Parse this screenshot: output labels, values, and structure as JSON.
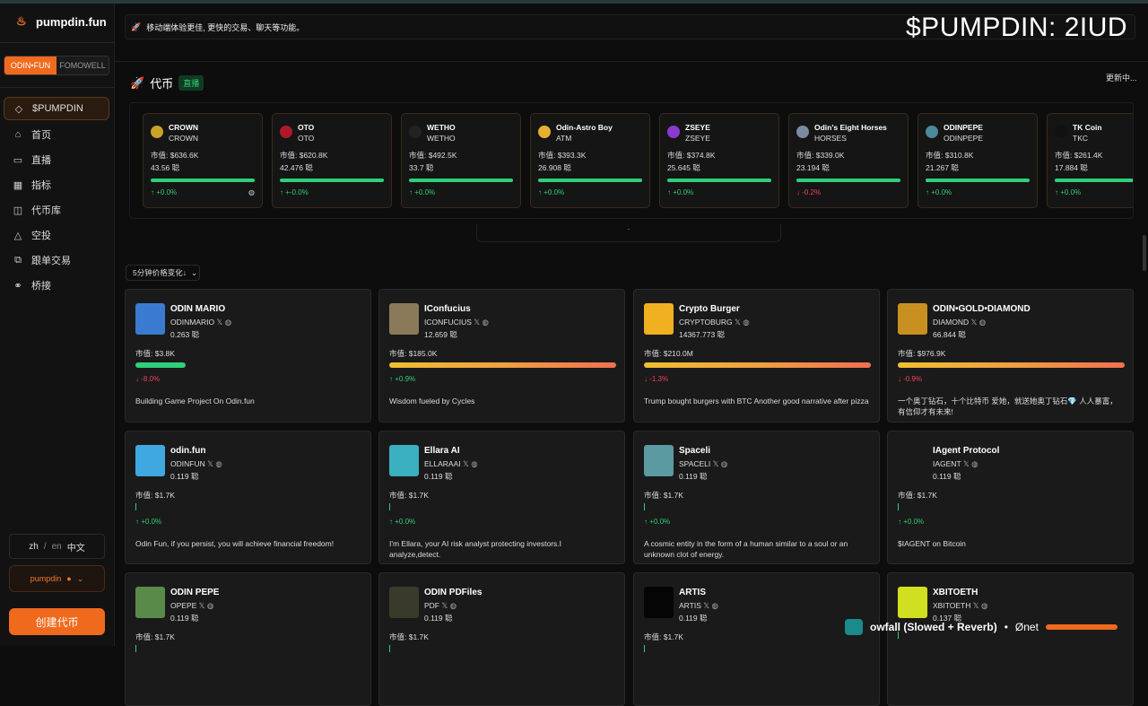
{
  "app": {
    "name": "pumpdin.fun"
  },
  "switch": {
    "active": "ODIN•FUN",
    "inactive": "FOMOWELL"
  },
  "nav": [
    {
      "label": "$PUMPDIN",
      "icon": "◇"
    },
    {
      "label": "首页",
      "icon": "⌂"
    },
    {
      "label": "直播",
      "icon": "▭"
    },
    {
      "label": "指标",
      "icon": "▦"
    },
    {
      "label": "代币库",
      "icon": "◫"
    },
    {
      "label": "空投",
      "icon": "△"
    },
    {
      "label": "跟单交易",
      "icon": "⧉"
    },
    {
      "label": "桥接",
      "icon": "⚭"
    }
  ],
  "lang": {
    "a": "zh",
    "sep": "/",
    "b": "en",
    "c": "中文"
  },
  "user": {
    "name": "pumpdin"
  },
  "create_label": "创建代币",
  "banner": {
    "text": "移动端体验更佳, 更快的交易、聊天等功能。"
  },
  "ticker": "$PUMPDIN: 2IUD",
  "section": {
    "title": "代币",
    "live": "直播",
    "updating": "更新中..."
  },
  "trending": [
    {
      "name": "CROWN",
      "symbol": "CROWN",
      "mcap": "市值: $636.6K",
      "holders": "43.56 聪",
      "change": "↑ +0.0%",
      "dir": "up",
      "color": "#c9a227"
    },
    {
      "name": "OTO",
      "symbol": "OTO",
      "mcap": "市值: $620.8K",
      "holders": "42.476 聪",
      "change": "↑ +-0.0%",
      "dir": "up",
      "color": "#b0182a"
    },
    {
      "name": "WETHO",
      "symbol": "WETHO",
      "mcap": "市值: $492.5K",
      "holders": "33.7 聪",
      "change": "↑ +0.0%",
      "dir": "up",
      "color": "#222222"
    },
    {
      "name": "Odin-Astro Boy",
      "symbol": "ATM",
      "mcap": "市值: $393.3K",
      "holders": "26.908 聪",
      "change": "↑ +0.0%",
      "dir": "up",
      "color": "#e8b030"
    },
    {
      "name": "ZSEYE",
      "symbol": "ZSEYE",
      "mcap": "市值: $374.8K",
      "holders": "25.645 聪",
      "change": "↑ +0.0%",
      "dir": "up",
      "color": "#8a3ad0"
    },
    {
      "name": "Odin's Eight Horses",
      "symbol": "HORSES",
      "mcap": "市值: $339.0K",
      "holders": "23.194 聪",
      "change": "↓ -0.2%",
      "dir": "down",
      "color": "#7a8aa0"
    },
    {
      "name": "ODINPEPE",
      "symbol": "ODINPEPE",
      "mcap": "市值: $310.8K",
      "holders": "21.267 聪",
      "change": "↑ +0.0%",
      "dir": "up",
      "color": "#4a8a9a"
    },
    {
      "name": "TK Coin",
      "symbol": "TKC",
      "mcap": "市值: $261.4K",
      "holders": "17.884 聪",
      "change": "↑ +0.0%",
      "dir": "up",
      "color": "#111111"
    }
  ],
  "sort": {
    "label": "5分钟价格变化↓"
  },
  "cards": [
    {
      "name": "ODIN MARIO",
      "symbol": "ODINMARIO",
      "holders": "0.263 聪",
      "mcap": "市值: $3.8K",
      "change": "↓ -8.0%",
      "dir": "down",
      "bar": 0.22,
      "bar_color": "#2fd07a",
      "desc": "Building Game Project On Odin.fun",
      "img": "#3a7ad0"
    },
    {
      "name": "IConfucius",
      "symbol": "ICONFUCIUS",
      "holders": "12.659 聪",
      "mcap": "市值: $185.0K",
      "change": "↑ +0.9%",
      "dir": "up",
      "bar": 1.0,
      "bar_color": "grad",
      "desc": "Wisdom fueled by Cycles",
      "img": "#8a7a5a"
    },
    {
      "name": "Crypto Burger",
      "symbol": "CRYPTOBURG",
      "holders": "14367.773 聪",
      "mcap": "市值: $210.0M",
      "change": "↓ -1.3%",
      "dir": "down",
      "bar": 1.0,
      "bar_color": "grad",
      "desc": "Trump bought burgers with BTC Another good narrative after pizza",
      "img": "#f0b020"
    },
    {
      "name": "ODIN•GOLD•DIAMOND",
      "symbol": "DIAMOND",
      "holders": "66.844 聪",
      "mcap": "市值: $976.9K",
      "change": "↓ -0.9%",
      "dir": "down",
      "bar": 1.0,
      "bar_color": "grad",
      "desc": "一个奥丁钻石，十个比特币 爱她，就送她奥丁钻石💎 人人暴富，有信仰才有未来!",
      "img": "#c89020"
    },
    {
      "name": "odin.fun",
      "symbol": "ODINFUN",
      "holders": "0.119 聪",
      "mcap": "市值: $1.7K",
      "change": "↑ +0.0%",
      "dir": "up",
      "bar": 0,
      "bar_color": "thin",
      "desc": "Odin Fun, if you persist, you will achieve financial freedom!",
      "img": "#40a8e0"
    },
    {
      "name": "Ellara AI",
      "symbol": "ELLARAAI",
      "holders": "0.119 聪",
      "mcap": "市值: $1.7K",
      "change": "↑ +0.0%",
      "dir": "up",
      "bar": 0,
      "bar_color": "thin",
      "desc": "I'm Ellara, your AI risk analyst protecting investors.I analyze,detect.",
      "img": "#3ab0c0"
    },
    {
      "name": "Spaceli",
      "symbol": "SPACELI",
      "holders": "0.119 聪",
      "mcap": "市值: $1.7K",
      "change": "↑ +0.0%",
      "dir": "up",
      "bar": 0,
      "bar_color": "thin",
      "desc": "A cosmic entity in the form of a human similar to a soul or an unknown clot of energy.",
      "img": "#5a9aa0"
    },
    {
      "name": "IAgent Protocol",
      "symbol": "IAGENT",
      "holders": "0.119 聪",
      "mcap": "市值: $1.7K",
      "change": "↑ +0.0%",
      "dir": "up",
      "bar": 0,
      "bar_color": "thin",
      "desc": "$IAGENT on Bitcoin",
      "img": "#1a1a1a"
    },
    {
      "name": "ODIN PEPE",
      "symbol": "OPEPE",
      "holders": "0.119 聪",
      "mcap": "市值: $1.7K",
      "change": "",
      "dir": "up",
      "bar": 0,
      "bar_color": "thin",
      "desc": "",
      "img": "#5a8a4a"
    },
    {
      "name": "ODIN PDFiles",
      "symbol": "PDF",
      "holders": "0.119 聪",
      "mcap": "市值: $1.7K",
      "change": "",
      "dir": "up",
      "bar": 0,
      "bar_color": "thin",
      "desc": "",
      "img": "#3a3a2a"
    },
    {
      "name": "ARTIS",
      "symbol": "ARTIS",
      "holders": "0.119 聪",
      "mcap": "市值: $1.7K",
      "change": "",
      "dir": "up",
      "bar": 0,
      "bar_color": "thin",
      "desc": "",
      "img": "#050505"
    },
    {
      "name": "XBITOETH",
      "symbol": "XBITOETH",
      "holders": "0.137 聪",
      "mcap": "",
      "change": "",
      "dir": "up",
      "bar": 0,
      "bar_color": "thin",
      "desc": "",
      "img": "#d0e020"
    }
  ],
  "player": {
    "track": "owfall (Slowed + Reverb)",
    "sep": "•",
    "artist": "Ønet"
  }
}
